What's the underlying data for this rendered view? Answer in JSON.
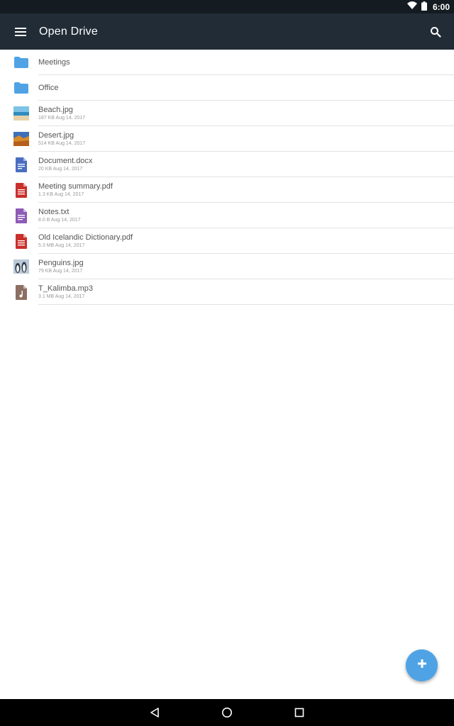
{
  "status_bar": {
    "time": "6:00",
    "icons": [
      "wifi-icon",
      "battery-icon"
    ]
  },
  "toolbar": {
    "title": "Open Drive",
    "menu_icon": "hamburger-menu-icon",
    "search_icon": "search-icon"
  },
  "files": [
    {
      "name": "Meetings",
      "meta": "",
      "type": "folder",
      "icon": "folder-icon"
    },
    {
      "name": "Office",
      "meta": "",
      "type": "folder",
      "icon": "folder-icon"
    },
    {
      "name": "Beach.jpg",
      "meta": "187 KB Aug 14, 2017",
      "type": "image",
      "icon": "beach-thumbnail-icon"
    },
    {
      "name": "Desert.jpg",
      "meta": "514 KB Aug 14, 2017",
      "type": "image",
      "icon": "desert-thumbnail-icon"
    },
    {
      "name": "Document.docx",
      "meta": "20 KB Aug 14, 2017",
      "type": "docx",
      "icon": "word-document-icon"
    },
    {
      "name": "Meeting summary.pdf",
      "meta": "1.3 KB Aug 14, 2017",
      "type": "pdf",
      "icon": "pdf-icon"
    },
    {
      "name": "Notes.txt",
      "meta": "8.0 B Aug 14, 2017",
      "type": "txt",
      "icon": "text-file-icon"
    },
    {
      "name": "Old Icelandic Dictionary.pdf",
      "meta": "5.3 MB Aug 14, 2017",
      "type": "pdf",
      "icon": "pdf-icon"
    },
    {
      "name": "Penguins.jpg",
      "meta": "79 KB Aug 14, 2017",
      "type": "image",
      "icon": "penguins-thumbnail-icon"
    },
    {
      "name": "T_Kalimba.mp3",
      "meta": "3.1 MB Aug 14, 2017",
      "type": "audio",
      "icon": "audio-file-icon"
    }
  ],
  "fab": {
    "icon": "plus-icon"
  },
  "nav_bar": {
    "icons": [
      "back-icon",
      "home-icon",
      "recents-icon"
    ]
  },
  "colors": {
    "toolbar": "#212c36",
    "status_bar": "#141c22",
    "folder": "#4fa3e5",
    "fab": "#4fa3e5",
    "pdf": "#c9302c",
    "docx": "#4a6fc0",
    "txt": "#8e5bb5",
    "audio": "#8d6e63"
  }
}
